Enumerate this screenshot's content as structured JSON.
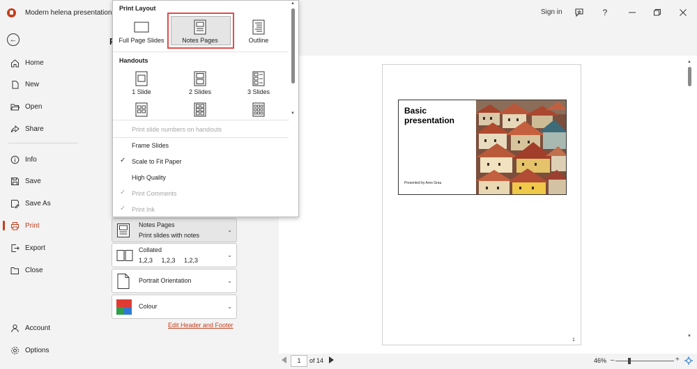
{
  "titlebar": {
    "doc_title": "Modern helena presentation",
    "sign_in": "Sign in",
    "help": "?",
    "icons": [
      "feedback-icon",
      "help-icon",
      "minimize-icon",
      "restore-icon",
      "close-icon"
    ]
  },
  "nav": {
    "items": [
      {
        "label": "Home",
        "icon": "home-icon"
      },
      {
        "label": "New",
        "icon": "new-document-icon"
      },
      {
        "label": "Open",
        "icon": "folder-open-icon"
      },
      {
        "label": "Share",
        "icon": "share-icon"
      },
      {
        "label": "Info",
        "icon": "info-icon"
      },
      {
        "label": "Save",
        "icon": "save-icon"
      },
      {
        "label": "Save As",
        "icon": "save-as-icon"
      },
      {
        "label": "Print",
        "icon": "print-icon",
        "active": true
      },
      {
        "label": "Export",
        "icon": "export-icon"
      },
      {
        "label": "Close",
        "icon": "folder-close-icon"
      },
      {
        "label": "Account",
        "icon": "account-icon"
      },
      {
        "label": "Options",
        "icon": "options-icon"
      }
    ]
  },
  "dropdown": {
    "print_layout_header": "Print Layout",
    "layouts": [
      {
        "label": "Full Page Slides"
      },
      {
        "label": "Notes Pages",
        "selected": true
      },
      {
        "label": "Outline"
      }
    ],
    "handouts_header": "Handouts",
    "handouts": [
      {
        "label": "1 Slide"
      },
      {
        "label": "2 Slides"
      },
      {
        "label": "3 Slides"
      }
    ],
    "options": [
      {
        "label": "Print slide numbers on handouts",
        "checked": false,
        "disabled": true
      },
      {
        "label": "Frame Slides",
        "checked": false,
        "disabled": false
      },
      {
        "label": "Scale to Fit Paper",
        "checked": true,
        "disabled": false
      },
      {
        "label": "High Quality",
        "checked": false,
        "disabled": false
      },
      {
        "label": "Print Comments",
        "checked": true,
        "disabled": true
      },
      {
        "label": "Print Ink",
        "checked": true,
        "disabled": true
      }
    ]
  },
  "settings": {
    "layout": {
      "line1": "Notes Pages",
      "line2": "Print slides with notes"
    },
    "collation": {
      "line1": "Collated",
      "line2": "1,2,3     1,2,3     1,2,3"
    },
    "orientation": {
      "line1": "Portrait Orientation"
    },
    "color": {
      "line1": "Colour"
    },
    "edit_link": "Edit Header and Footer"
  },
  "preview": {
    "slide_title": "Basic presentation",
    "presenter": "Presented by Ares Grau",
    "page_number": "1"
  },
  "bottombar": {
    "current_page": "1",
    "of_pages": "of 14",
    "zoom": "46%"
  },
  "colors": {
    "accent": "#c43e1c",
    "highlight": "#e14b4b"
  }
}
